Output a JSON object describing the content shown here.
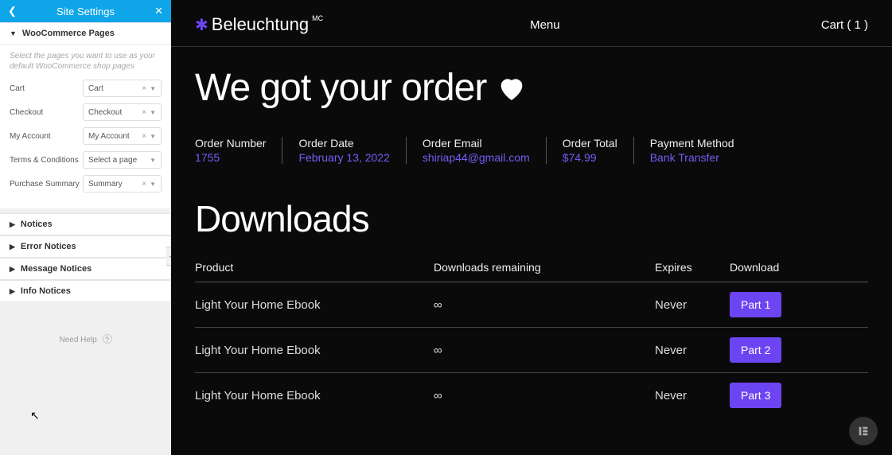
{
  "sidebar": {
    "title": "Site Settings",
    "panels": {
      "woo": {
        "title": "WooCommerce Pages"
      },
      "notices": {
        "title": "Notices"
      },
      "error_notices": {
        "title": "Error Notices"
      },
      "message_notices": {
        "title": "Message Notices"
      },
      "info_notices": {
        "title": "Info Notices"
      }
    },
    "helper": "Select the pages you want to use as your default WooCommerce shop pages",
    "rows": [
      {
        "label": "Cart",
        "value": "Cart",
        "clearable": true
      },
      {
        "label": "Checkout",
        "value": "Checkout",
        "clearable": true
      },
      {
        "label": "My Account",
        "value": "My Account",
        "clearable": true
      },
      {
        "label": "Terms & Conditions",
        "value": "Select a page",
        "clearable": false
      },
      {
        "label": "Purchase Summary",
        "value": "Summary",
        "clearable": true
      }
    ],
    "need_help": "Need Help"
  },
  "preview": {
    "brand": "Beleuchtung",
    "brand_sup": "MC",
    "menu": "Menu",
    "cart": "Cart ( 1 )",
    "hero": "We got your order",
    "meta": [
      {
        "label": "Order Number",
        "value": "1755"
      },
      {
        "label": "Order Date",
        "value": "February 13, 2022"
      },
      {
        "label": "Order Email",
        "value": "shiriap44@gmail.com"
      },
      {
        "label": "Order Total",
        "value": "$74.99"
      },
      {
        "label": "Payment Method",
        "value": "Bank Transfer"
      }
    ],
    "downloads_heading": "Downloads",
    "dl_head": {
      "product": "Product",
      "remaining": "Downloads remaining",
      "expires": "Expires",
      "download": "Download"
    },
    "dl_rows": [
      {
        "product": "Light Your Home Ebook",
        "remaining": "∞",
        "expires": "Never",
        "btn": "Part 1"
      },
      {
        "product": "Light Your Home Ebook",
        "remaining": "∞",
        "expires": "Never",
        "btn": "Part 2"
      },
      {
        "product": "Light Your Home Ebook",
        "remaining": "∞",
        "expires": "Never",
        "btn": "Part 3"
      }
    ]
  }
}
